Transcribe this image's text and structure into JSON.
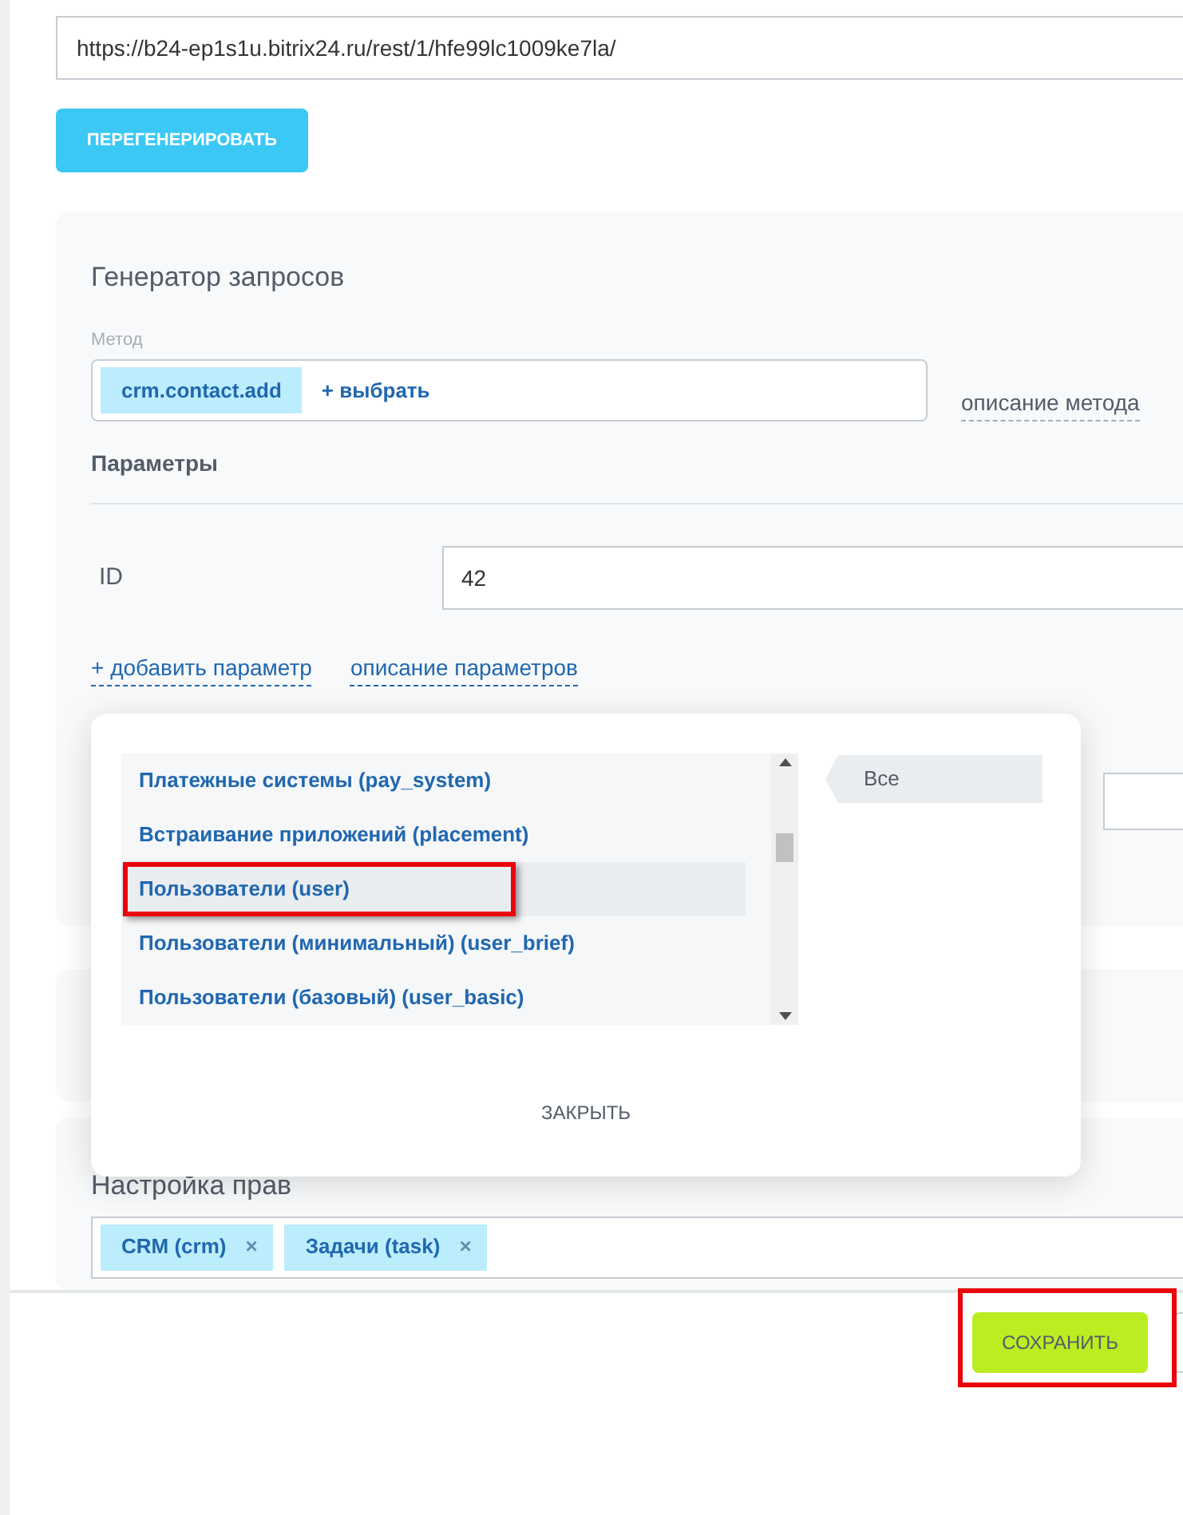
{
  "webhook": {
    "url": "https://b24-ep1s1u.bitrix24.ru/rest/1/hfe99lc1009ke7la/",
    "regenerate_button": "ПЕРЕГЕНЕРИРОВАТЬ"
  },
  "generator": {
    "title": "Генератор запросов",
    "method_label": "Метод",
    "method_tag": "crm.contact.add",
    "choose_link": "+ выбрать",
    "method_help_link": "описание метода",
    "params_title": "Параметры",
    "params": [
      {
        "name": "ID",
        "value": "42"
      }
    ],
    "add_param_link": "+ добавить параметр",
    "params_help_link": "описание параметров"
  },
  "scope_popup": {
    "items": [
      {
        "label": "Платежные системы (pay_system)",
        "selected": false,
        "highlighted": false
      },
      {
        "label": "Встраивание приложений (placement)",
        "selected": false,
        "highlighted": false
      },
      {
        "label": "Пользователи (user)",
        "selected": true,
        "highlighted": true
      },
      {
        "label": "Пользователи (минимальный) (user_brief)",
        "selected": false,
        "highlighted": false
      },
      {
        "label": "Пользователи (базовый) (user_basic)",
        "selected": false,
        "highlighted": false
      }
    ],
    "filter_tag": "Все",
    "close_button": "ЗАКРЫТЬ"
  },
  "permissions": {
    "title": "Настройка прав",
    "tags": [
      {
        "label": "CRM (crm)",
        "remove": "×"
      },
      {
        "label": "Задачи (task)",
        "remove": "×"
      }
    ]
  },
  "footer": {
    "save_button": "СОХРАНИТЬ",
    "save_highlighted": true
  }
}
